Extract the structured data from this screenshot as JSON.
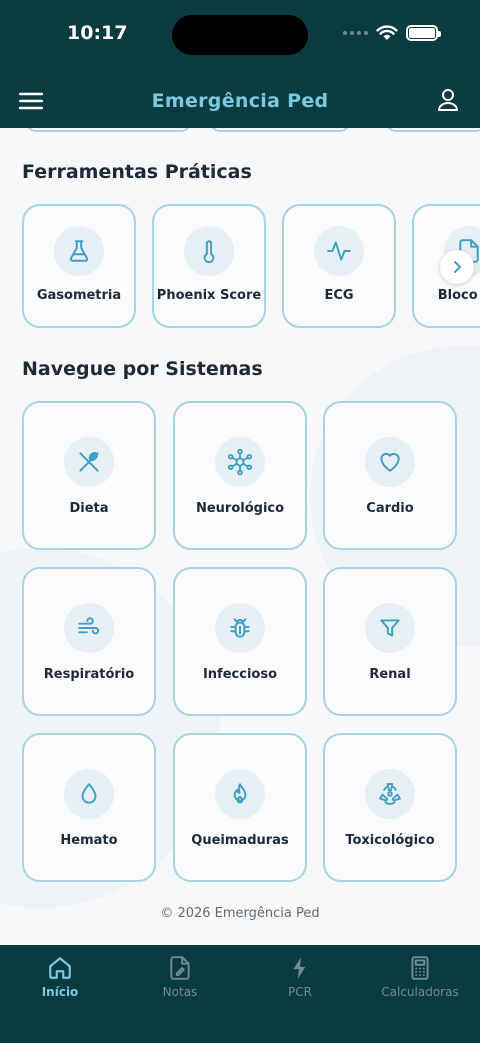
{
  "status_bar": {
    "time": "10:17"
  },
  "header": {
    "title": "Emergência Ped"
  },
  "tools": {
    "title": "Ferramentas Práticas",
    "items": [
      {
        "label": "Gasometria",
        "icon": "flask-icon"
      },
      {
        "label": "Phoenix Score",
        "icon": "thermometer-icon"
      },
      {
        "label": "ECG",
        "icon": "heartbeat-icon"
      },
      {
        "label": "Bloco de",
        "icon": "document-icon"
      }
    ]
  },
  "systems": {
    "title": "Navegue por Sistemas",
    "items": [
      {
        "label": "Dieta",
        "icon": "utensils-icon"
      },
      {
        "label": "Neurológico",
        "icon": "network-icon"
      },
      {
        "label": "Cardio",
        "icon": "heart-icon"
      },
      {
        "label": "Respiratório",
        "icon": "wind-icon"
      },
      {
        "label": "Infeccioso",
        "icon": "bug-icon"
      },
      {
        "label": "Renal",
        "icon": "filter-icon"
      },
      {
        "label": "Hemato",
        "icon": "droplet-icon"
      },
      {
        "label": "Queimaduras",
        "icon": "flame-icon"
      },
      {
        "label": "Toxicológico",
        "icon": "radiation-icon"
      }
    ]
  },
  "footer": {
    "copyright": "© 2026 Emergência Ped"
  },
  "tab_bar": {
    "items": [
      {
        "label": "Início",
        "icon": "home-icon",
        "active": true
      },
      {
        "label": "Notas",
        "icon": "notes-icon",
        "active": false
      },
      {
        "label": "PCR",
        "icon": "bolt-icon",
        "active": false
      },
      {
        "label": "Calculadoras",
        "icon": "calculator-icon",
        "active": false
      }
    ]
  },
  "colors": {
    "header_bg": "#0a3b40",
    "accent": "#7cc8df",
    "icon": "#3f9fc4",
    "card_border": "#a9d2e2"
  }
}
